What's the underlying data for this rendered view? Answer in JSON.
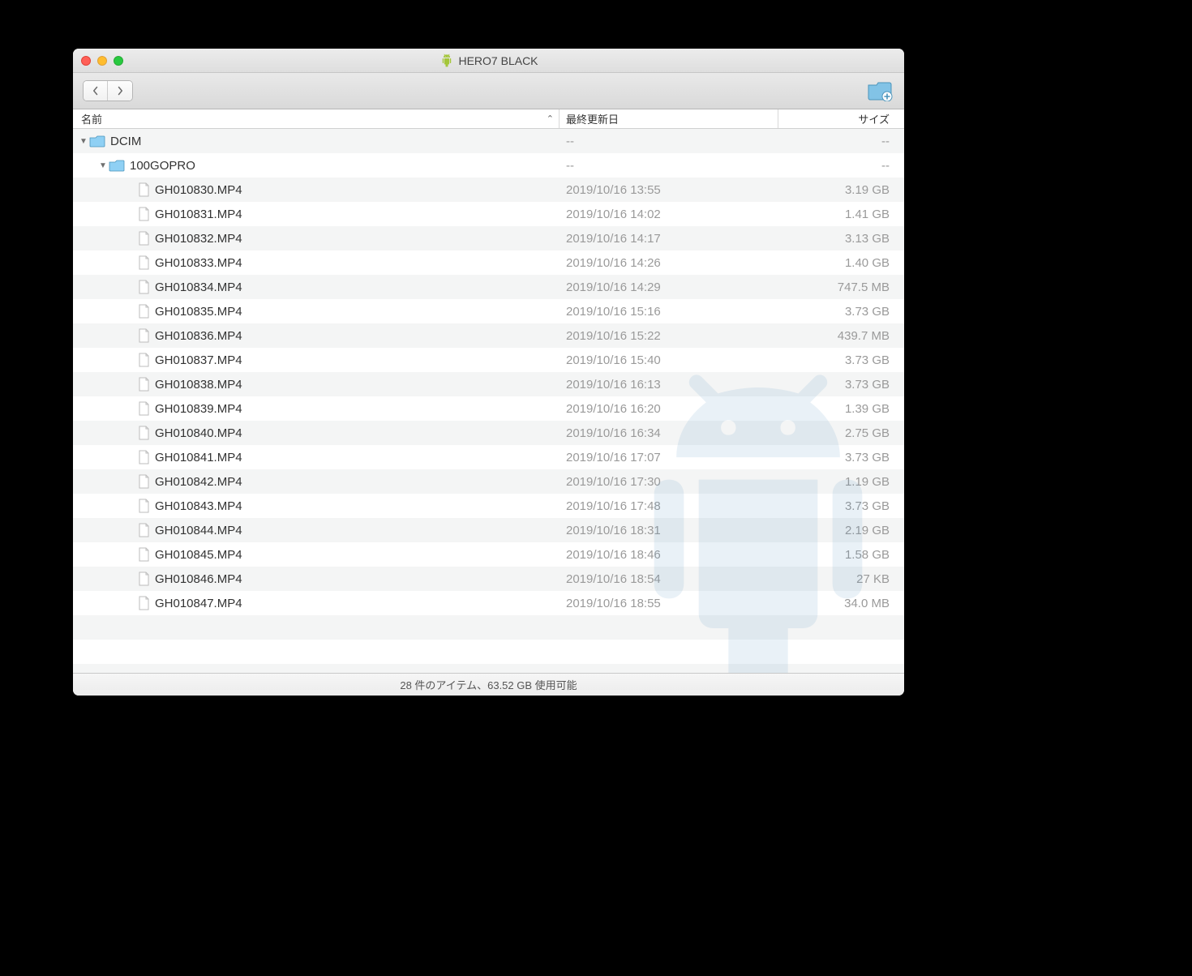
{
  "window": {
    "title": "HERO7 BLACK"
  },
  "columns": {
    "name": "名前",
    "date": "最終更新日",
    "size": "サイズ"
  },
  "tree": [
    {
      "type": "folder",
      "level": 0,
      "expanded": true,
      "name": "DCIM",
      "date": "--",
      "size": "--"
    },
    {
      "type": "folder",
      "level": 1,
      "expanded": true,
      "name": "100GOPRO",
      "date": "--",
      "size": "--"
    },
    {
      "type": "file",
      "level": 2,
      "name": "GH010830.MP4",
      "date": "2019/10/16 13:55",
      "size": "3.19 GB"
    },
    {
      "type": "file",
      "level": 2,
      "name": "GH010831.MP4",
      "date": "2019/10/16 14:02",
      "size": "1.41 GB"
    },
    {
      "type": "file",
      "level": 2,
      "name": "GH010832.MP4",
      "date": "2019/10/16 14:17",
      "size": "3.13 GB"
    },
    {
      "type": "file",
      "level": 2,
      "name": "GH010833.MP4",
      "date": "2019/10/16 14:26",
      "size": "1.40 GB"
    },
    {
      "type": "file",
      "level": 2,
      "name": "GH010834.MP4",
      "date": "2019/10/16 14:29",
      "size": "747.5 MB"
    },
    {
      "type": "file",
      "level": 2,
      "name": "GH010835.MP4",
      "date": "2019/10/16 15:16",
      "size": "3.73 GB"
    },
    {
      "type": "file",
      "level": 2,
      "name": "GH010836.MP4",
      "date": "2019/10/16 15:22",
      "size": "439.7 MB"
    },
    {
      "type": "file",
      "level": 2,
      "name": "GH010837.MP4",
      "date": "2019/10/16 15:40",
      "size": "3.73 GB"
    },
    {
      "type": "file",
      "level": 2,
      "name": "GH010838.MP4",
      "date": "2019/10/16 16:13",
      "size": "3.73 GB"
    },
    {
      "type": "file",
      "level": 2,
      "name": "GH010839.MP4",
      "date": "2019/10/16 16:20",
      "size": "1.39 GB"
    },
    {
      "type": "file",
      "level": 2,
      "name": "GH010840.MP4",
      "date": "2019/10/16 16:34",
      "size": "2.75 GB"
    },
    {
      "type": "file",
      "level": 2,
      "name": "GH010841.MP4",
      "date": "2019/10/16 17:07",
      "size": "3.73 GB"
    },
    {
      "type": "file",
      "level": 2,
      "name": "GH010842.MP4",
      "date": "2019/10/16 17:30",
      "size": "1.19 GB"
    },
    {
      "type": "file",
      "level": 2,
      "name": "GH010843.MP4",
      "date": "2019/10/16 17:48",
      "size": "3.73 GB"
    },
    {
      "type": "file",
      "level": 2,
      "name": "GH010844.MP4",
      "date": "2019/10/16 18:31",
      "size": "2.19 GB"
    },
    {
      "type": "file",
      "level": 2,
      "name": "GH010845.MP4",
      "date": "2019/10/16 18:46",
      "size": "1.58 GB"
    },
    {
      "type": "file",
      "level": 2,
      "name": "GH010846.MP4",
      "date": "2019/10/16 18:54",
      "size": "27 KB"
    },
    {
      "type": "file",
      "level": 2,
      "name": "GH010847.MP4",
      "date": "2019/10/16 18:55",
      "size": "34.0 MB"
    }
  ],
  "status": "28 件のアイテム、63.52 GB 使用可能"
}
